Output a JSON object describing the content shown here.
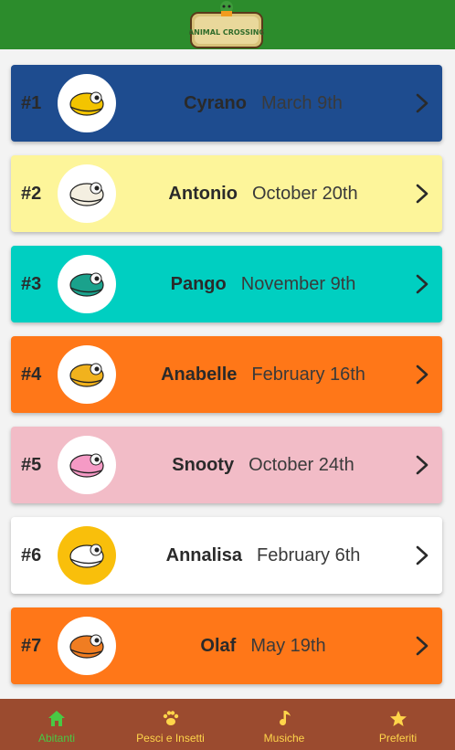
{
  "app": {
    "logo_text": "ANIMAL CROSSING"
  },
  "villagers": [
    {
      "rank": "#1",
      "name": "Cyrano",
      "birthday": "March 9th",
      "bg": "#1e4c8f",
      "avatar_bg": "#ffffff",
      "creature_color": "#f3c400"
    },
    {
      "rank": "#2",
      "name": "Antonio",
      "birthday": "October 20th",
      "bg": "#fdf59a",
      "avatar_bg": "#ffffff",
      "creature_color": "#f4efe1"
    },
    {
      "rank": "#3",
      "name": "Pango",
      "birthday": "November 9th",
      "bg": "#00cfc1",
      "avatar_bg": "#ffffff",
      "creature_color": "#1aa28c"
    },
    {
      "rank": "#4",
      "name": "Anabelle",
      "birthday": "February 16th",
      "bg": "#ff7718",
      "avatar_bg": "#ffffff",
      "creature_color": "#f1b21d"
    },
    {
      "rank": "#5",
      "name": "Snooty",
      "birthday": "October 24th",
      "bg": "#f2bcc7",
      "avatar_bg": "#ffffff",
      "creature_color": "#f59ac5"
    },
    {
      "rank": "#6",
      "name": "Annalisa",
      "birthday": "February 6th",
      "bg": "#ffffff",
      "avatar_bg": "#f9bf0b",
      "creature_color": "#ffffff"
    },
    {
      "rank": "#7",
      "name": "Olaf",
      "birthday": "May 19th",
      "bg": "#ff7718",
      "avatar_bg": "#ffffff",
      "creature_color": "#f07d22"
    }
  ],
  "bottom_nav": [
    {
      "label": "Abitanti",
      "icon": "home-icon",
      "active": true
    },
    {
      "label": "Pesci e Insetti",
      "icon": "paw-icon",
      "active": false
    },
    {
      "label": "Musiche",
      "icon": "music-note-icon",
      "active": false
    },
    {
      "label": "Preferiti",
      "icon": "star-icon",
      "active": false
    }
  ],
  "colors": {
    "header": "#2c8c2c",
    "bottom_nav": "#9b4b2f",
    "nav_inactive": "#ffd54a",
    "nav_active": "#49c944"
  }
}
